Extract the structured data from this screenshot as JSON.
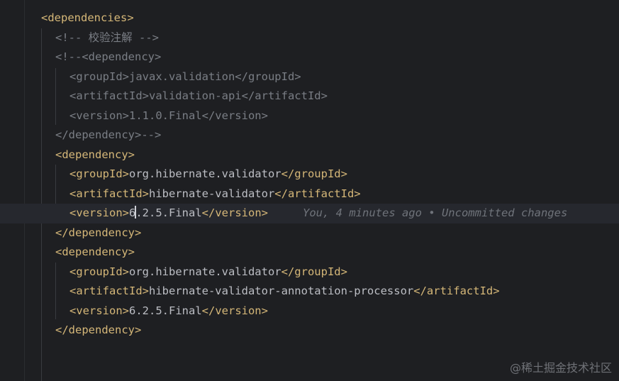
{
  "editor": {
    "lines": [
      {
        "indent": 0,
        "kind": "tag",
        "open": "<dependencies>"
      },
      {
        "indent": 1,
        "kind": "comment",
        "text": "<!-- 校验注解 -->"
      },
      {
        "indent": 1,
        "kind": "comment",
        "text": "<!--<dependency>"
      },
      {
        "indent": 2,
        "kind": "comment",
        "text": "<groupId>javax.validation</groupId>"
      },
      {
        "indent": 2,
        "kind": "comment",
        "text": "<artifactId>validation-api</artifactId>"
      },
      {
        "indent": 2,
        "kind": "comment",
        "text": "<version>1.1.0.Final</version>"
      },
      {
        "indent": 1,
        "kind": "comment",
        "text": "</dependency>-->"
      },
      {
        "indent": 1,
        "kind": "tag",
        "open": "<dependency>"
      },
      {
        "indent": 2,
        "kind": "element",
        "open": "<groupId>",
        "value": "org.hibernate.validator",
        "close": "</groupId>"
      },
      {
        "indent": 2,
        "kind": "element",
        "open": "<artifactId>",
        "value": "hibernate-validator",
        "close": "</artifactId>"
      },
      {
        "indent": 2,
        "kind": "element",
        "open": "<version>",
        "value_before_caret": "6",
        "value_after_caret": ".2.5.Final",
        "close": "</version>",
        "current": true,
        "blame": "You, 4 minutes ago • Uncommitted changes"
      },
      {
        "indent": 1,
        "kind": "tag",
        "open": "</dependency>"
      },
      {
        "indent": 1,
        "kind": "tag",
        "open": "<dependency>"
      },
      {
        "indent": 2,
        "kind": "element",
        "open": "<groupId>",
        "value": "org.hibernate.validator",
        "close": "</groupId>"
      },
      {
        "indent": 2,
        "kind": "element",
        "open": "<artifactId>",
        "value": "hibernate-validator-annotation-processor",
        "close": "</artifactId>"
      },
      {
        "indent": 2,
        "kind": "element",
        "open": "<version>",
        "value": "6.2.5.Final",
        "close": "</version>"
      },
      {
        "indent": 1,
        "kind": "tag",
        "open": "</dependency>"
      }
    ]
  },
  "watermark": "@稀土掘金技术社区",
  "colors": {
    "background": "#1e1f22",
    "tag": "#d5b778",
    "comment": "#7a7e85",
    "text": "#bcbec4",
    "current_line": "#26282e"
  }
}
